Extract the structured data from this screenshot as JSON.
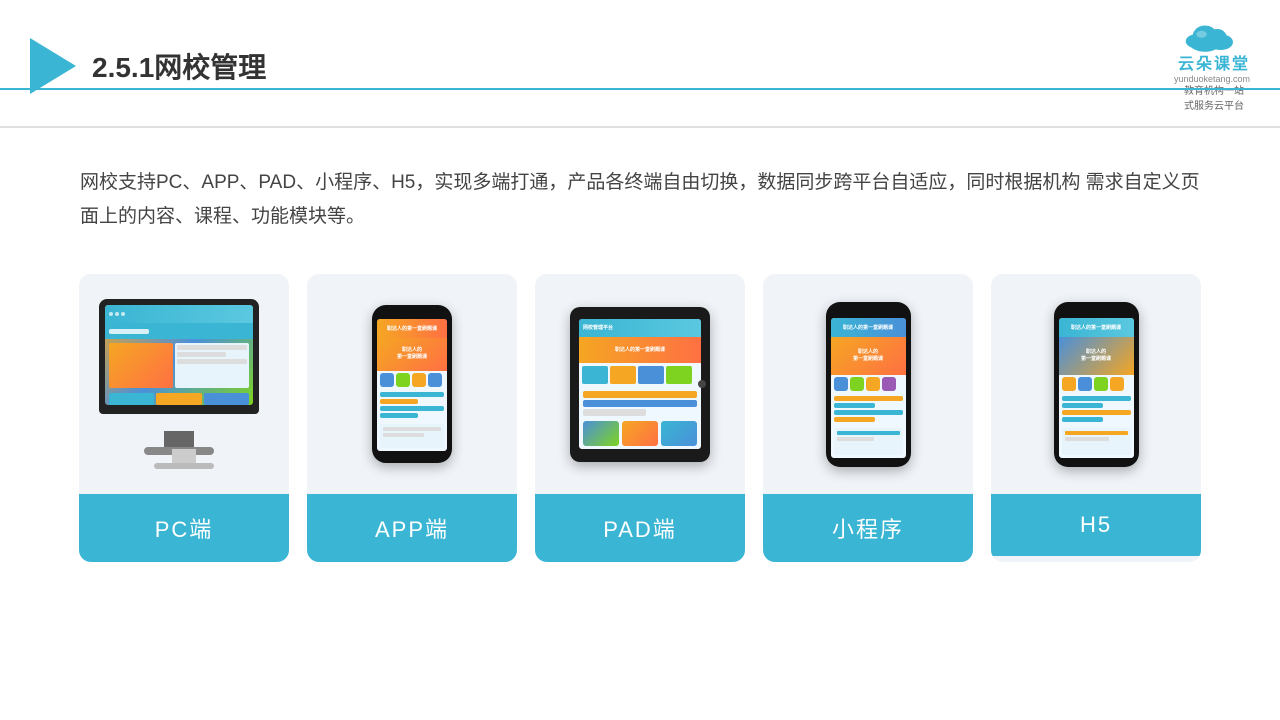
{
  "header": {
    "title": "2.5.1网校管理",
    "brand": {
      "name": "云朵课堂",
      "domain": "yunduoketang.com",
      "tagline": "教育机构一站\n式服务云平台"
    }
  },
  "description": "网校支持PC、APP、PAD、小程序、H5，实现多端打通，产品各终端自由切换，数据同步跨平台自适应，同时根据机构\n需求自定义页面上的内容、课程、功能模块等。",
  "cards": [
    {
      "id": "pc",
      "label": "PC端"
    },
    {
      "id": "app",
      "label": "APP端"
    },
    {
      "id": "pad",
      "label": "PAD端"
    },
    {
      "id": "mini",
      "label": "小程序"
    },
    {
      "id": "h5",
      "label": "H5"
    }
  ],
  "accent_color": "#3ab5d3"
}
